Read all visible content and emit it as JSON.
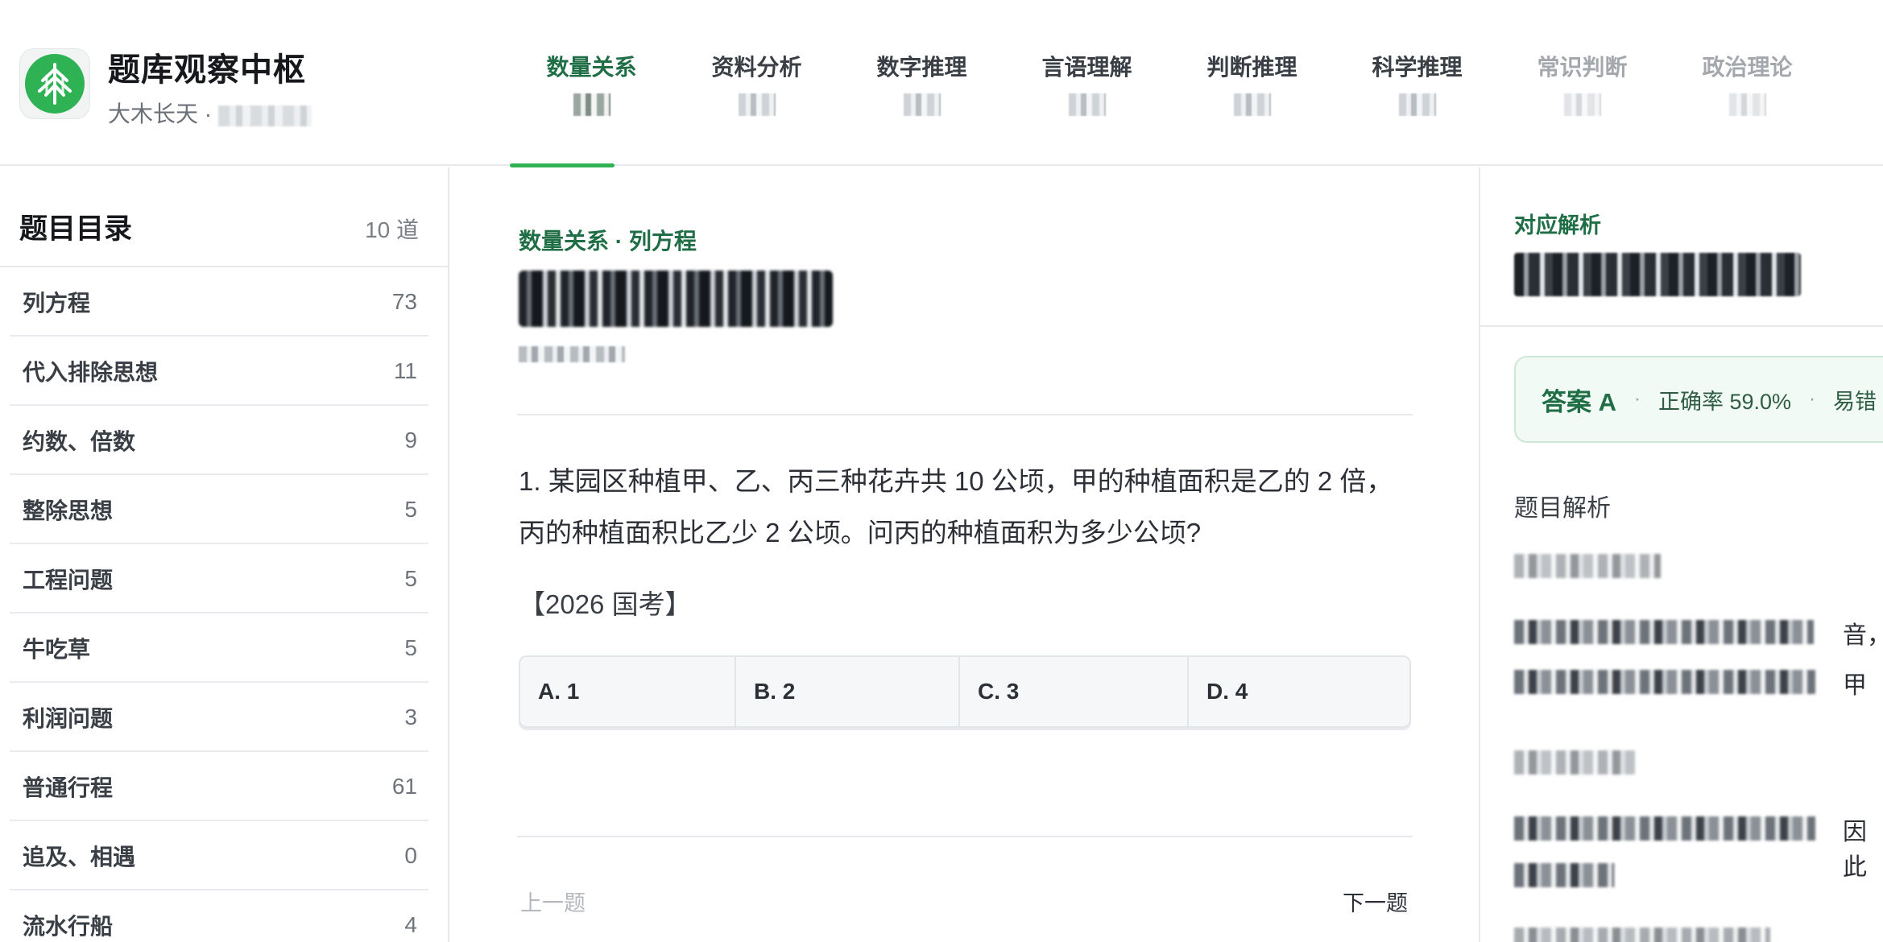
{
  "app": {
    "title": "题库观察中枢",
    "subtitle": "大木长天 ·"
  },
  "tabs": [
    {
      "label": "数量关系"
    },
    {
      "label": "资料分析"
    },
    {
      "label": "数字推理"
    },
    {
      "label": "言语理解"
    },
    {
      "label": "判断推理"
    },
    {
      "label": "科学推理"
    },
    {
      "label": "常识判断"
    },
    {
      "label": "政治理论"
    }
  ],
  "sidebar": {
    "title": "题目目录",
    "total": "10  道",
    "items": [
      {
        "label": "列方程",
        "count": "73"
      },
      {
        "label": "代入排除思想",
        "count": "11"
      },
      {
        "label": "约数、倍数",
        "count": "9"
      },
      {
        "label": "整除思想",
        "count": "5"
      },
      {
        "label": "工程问题",
        "count": "5"
      },
      {
        "label": "牛吃草",
        "count": "5"
      },
      {
        "label": "利润问题",
        "count": "3"
      },
      {
        "label": "普通行程",
        "count": "61"
      },
      {
        "label": "追及、相遇",
        "count": "0"
      },
      {
        "label": "流水行船",
        "count": "4"
      }
    ]
  },
  "main": {
    "breadcrumb": "数量关系 · 列方程",
    "question": "1. 某园区种植甲、乙、丙三种花卉共 10 公顷，甲的种植面积是乙的 2 倍，丙的种植面积比乙少 2 公顷。问丙的种植面积为多少公顷?",
    "source": "【2026 国考】",
    "options": [
      {
        "label": "A. 1"
      },
      {
        "label": "B. 2"
      },
      {
        "label": "C. 3"
      },
      {
        "label": "D. 4"
      }
    ],
    "prev": "上一题",
    "next": "下一题"
  },
  "panel": {
    "kicker": "对应解析",
    "answer": "答案 A",
    "accuracy": "正确率 59.0%",
    "error_prefix": "易错",
    "section_title": "题目解析",
    "fragments": [
      "音，",
      "甲",
      "因此"
    ]
  },
  "colors": {
    "brand_green": "#2eb254",
    "text_green": "#1f6e45",
    "answer_bg": "#f2faf5"
  }
}
